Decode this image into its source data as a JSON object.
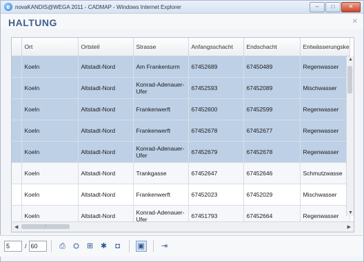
{
  "window": {
    "title": "novaKANDIS@WEGA 2011 - CADMAP - Windows Internet Explorer",
    "buttons": {
      "minimize": "–",
      "maximize": "□",
      "close": "✕"
    }
  },
  "page": {
    "title": "HALTUNG",
    "close_label": "✕"
  },
  "table": {
    "columns": [
      "Ort",
      "Ortsteil",
      "Strasse",
      "Anfangsschacht",
      "Endschacht",
      "Entwässerungske"
    ],
    "rows": [
      {
        "ort": "Koeln",
        "ortsteil": "Altstadt-Nord",
        "strasse": "Am Frankenturm",
        "anfang": "67452689",
        "end": "67450489",
        "entw": "Regenwasser",
        "state": "selected"
      },
      {
        "ort": "Koeln",
        "ortsteil": "Altstadt-Nord",
        "strasse": "Konrad-Adenauer-Ufer",
        "anfang": "67452593",
        "end": "67452089",
        "entw": "Mischwasser",
        "state": "selected"
      },
      {
        "ort": "Koeln",
        "ortsteil": "Altstadt-Nord",
        "strasse": "Frankenwerft",
        "anfang": "67452600",
        "end": "67452599",
        "entw": "Regenwasser",
        "state": "selected"
      },
      {
        "ort": "Koeln",
        "ortsteil": "Altstadt-Nord",
        "strasse": "Frankenwerft",
        "anfang": "67452678",
        "end": "67452677",
        "entw": "Regenwasser",
        "state": "selected"
      },
      {
        "ort": "Koeln",
        "ortsteil": "Altstadt-Nord",
        "strasse": "Konrad-Adenauer-Ufer",
        "anfang": "67452679",
        "end": "67452678",
        "entw": "Regenwasser",
        "state": "selected"
      },
      {
        "ort": "Koeln",
        "ortsteil": "Altstadt-Nord",
        "strasse": "Trankgasse",
        "anfang": "67452647",
        "end": "67452646",
        "entw": "Schmutzwasse",
        "state": "alt"
      },
      {
        "ort": "Koeln",
        "ortsteil": "Altstadt-Nord",
        "strasse": "Frankenwerft",
        "anfang": "67452023",
        "end": "67452029",
        "entw": "Mischwasser",
        "state": "plain"
      },
      {
        "ort": "Koeln",
        "ortsteil": "Altstadt-Nord",
        "strasse": "Konrad-Adenauer-Ufer",
        "anfang": "67451793",
        "end": "67452664",
        "entw": "Regenwasser",
        "state": "alt"
      }
    ]
  },
  "pager": {
    "current_page": "5",
    "separator": "/",
    "total_pages": "60"
  },
  "icons": [
    "print-icon",
    "export-icon",
    "grid-icon",
    "tools-icon",
    "filter-icon",
    "view-icon",
    "exit-icon"
  ]
}
